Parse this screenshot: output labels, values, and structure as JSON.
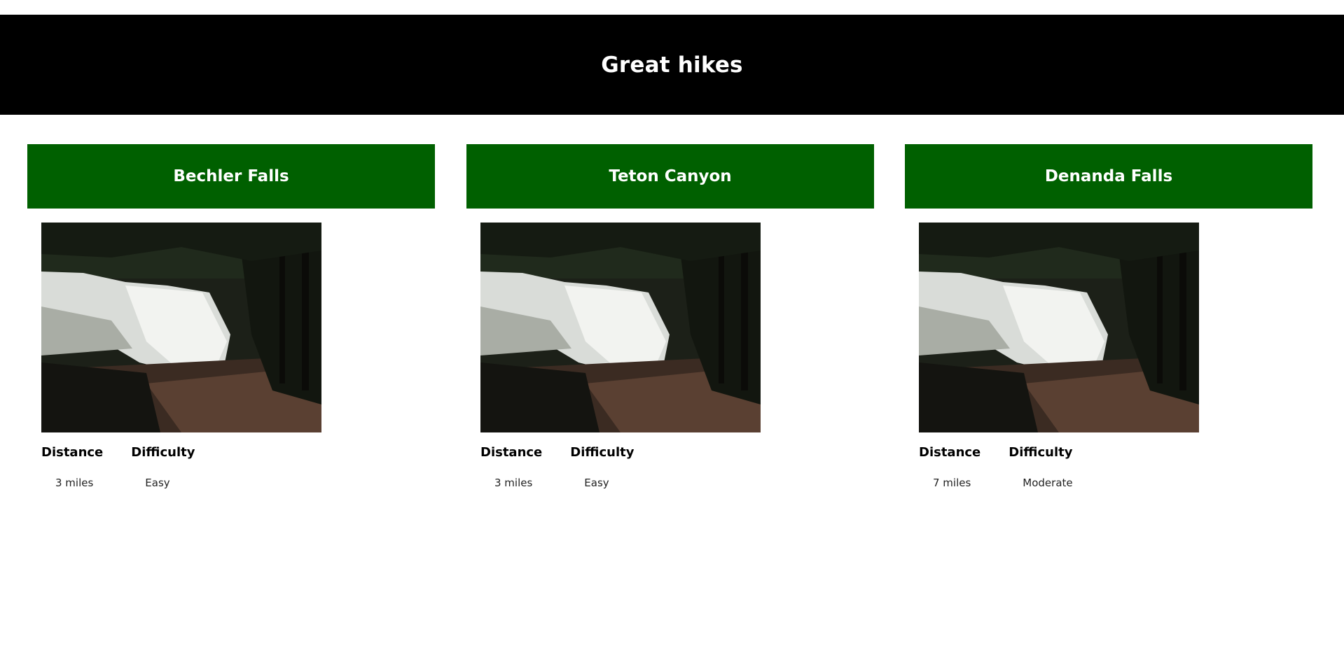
{
  "header": {
    "title": "Great hikes"
  },
  "hikes": [
    {
      "name": "Bechler Falls",
      "image_label": "waterfall photo",
      "distance_label": "Distance",
      "distance": "3 miles",
      "difficulty_label": "Difficulty",
      "difficulty": "Easy"
    },
    {
      "name": "Teton Canyon",
      "image_label": "waterfall photo",
      "distance_label": "Distance",
      "distance": "3 miles",
      "difficulty_label": "Difficulty",
      "difficulty": "Easy"
    },
    {
      "name": "Denanda Falls",
      "image_label": "waterfall photo",
      "distance_label": "Distance",
      "distance": "7 miles",
      "difficulty_label": "Difficulty",
      "difficulty": "Moderate"
    }
  ],
  "colors": {
    "header_bg": "#000000",
    "card_title_bg": "#006000",
    "title_text": "#ffffff"
  }
}
